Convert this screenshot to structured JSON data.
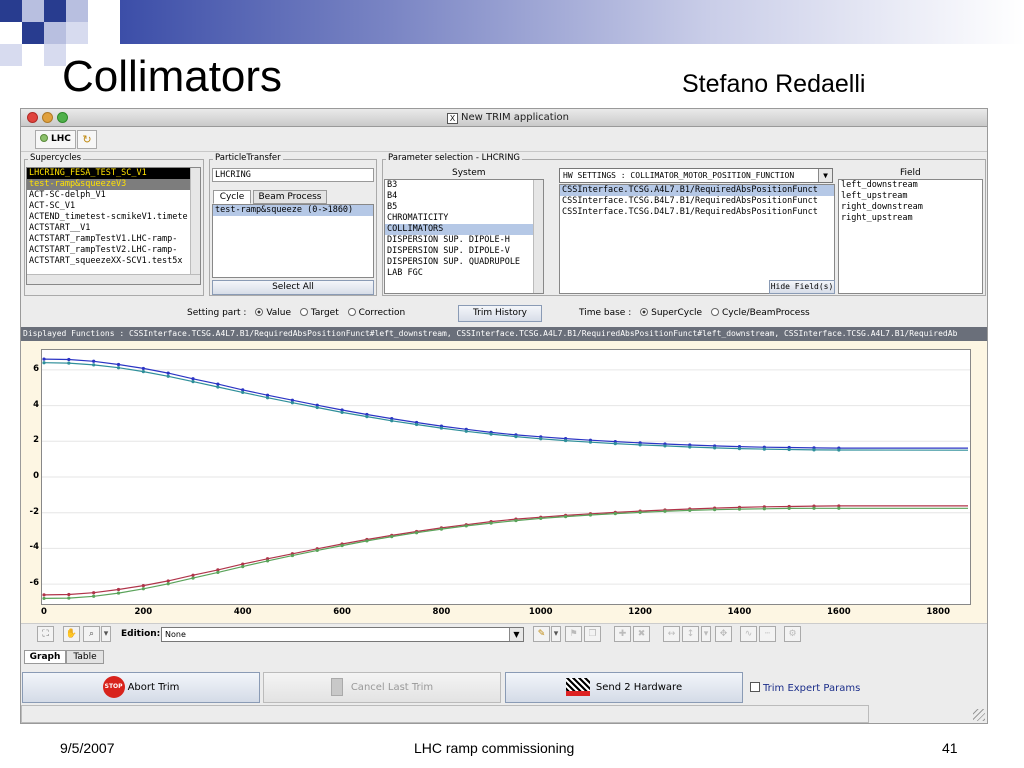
{
  "slide": {
    "title": "Collimators",
    "author": "Stefano Redaelli",
    "date": "9/5/2007",
    "center": "LHC ramp commissioning",
    "page": "41"
  },
  "window": {
    "title": "New TRIM application",
    "x_icon": "X",
    "accelerator_button": "LHC"
  },
  "supercycles": {
    "label": "Supercycles",
    "items": [
      "LHCRING_FESA_TEST_SC_V1",
      "test-ramp&squeezeV3",
      "ACT-SC-delph_V1",
      "ACT-SC_V1",
      "ACTEND_timetest-scmikeV1.timete",
      "ACTSTART__V1",
      "ACTSTART_rampTestV1.LHC-ramp-",
      "ACTSTART_rampTestV2.LHC-ramp-",
      "ACTSTART_squeezeXX-SCV1.test5x"
    ]
  },
  "particle_transfer": {
    "label": "ParticleTransfer",
    "value": "LHCRING",
    "tabs": [
      "Cycle",
      "Beam Process"
    ],
    "items": [
      "test-ramp&squeeze (0->1860)"
    ],
    "select_all": "Select All"
  },
  "parameter_selection": {
    "label": "Parameter selection - LHCRING",
    "system_header": "System",
    "systems": [
      "B3",
      "B4",
      "B5",
      "CHROMATICITY",
      "COLLIMATORS",
      "DISPERSION SUP. DIPOLE-H",
      "DISPERSION SUP. DIPOLE-V",
      "DISPERSION SUP. QUADRUPOLE",
      "LAB FGC"
    ],
    "selected_system": "COLLIMATORS",
    "hw_settings": "HW SETTINGS : COLLIMATOR_MOTOR_POSITION_FUNCTION",
    "parameters": [
      "CSSInterface.TCSG.A4L7.B1/RequiredAbsPositionFunct",
      "CSSInterface.TCSG.B4L7.B1/RequiredAbsPositionFunct",
      "CSSInterface.TCSG.D4L7.B1/RequiredAbsPositionFunct"
    ],
    "field_header": "Field",
    "fields": [
      "left_downstream",
      "left_upstream",
      "right_downstream",
      "right_upstream"
    ],
    "hide_fields": "Hide Field(s)"
  },
  "settings_bar": {
    "setting_part_label": "Setting part :",
    "setting_part_options": [
      "Value",
      "Target",
      "Correction"
    ],
    "setting_part_selected": "Value",
    "trim_history": "Trim History",
    "time_base_label": "Time base :",
    "time_base_options": [
      "SuperCycle",
      "Cycle/BeamProcess"
    ],
    "time_base_selected": "SuperCycle"
  },
  "displayed_functions": "Displayed Functions : CSSInterface.TCSG.A4L7.B1/RequiredAbsPositionFunct#left_downstream, CSSInterface.TCSG.A4L7.B1/RequiredAbsPositionFunct#left_downstream, CSSInterface.TCSG.A4L7.B1/RequiredAb",
  "plot_tools": {
    "edition_label": "Edition:",
    "edition_value": "None"
  },
  "bottom_tabs": [
    "Graph",
    "Table"
  ],
  "actions": {
    "abort": "Abort Trim",
    "cancel": "Cancel Last Trim",
    "send": "Send 2 Hardware",
    "expert": "Trim Expert Params"
  },
  "colors": {
    "series_blue": "#2b34c4",
    "series_teal": "#2f8f9a",
    "series_red": "#b0344a",
    "series_green": "#5aa35a"
  },
  "chart_data": {
    "type": "line",
    "xlim": [
      0,
      1860
    ],
    "ylim": [
      -7,
      7
    ],
    "xticks": [
      "0",
      "200",
      "400",
      "600",
      "800",
      "1000",
      "1200",
      "1400",
      "1600",
      "1800"
    ],
    "yticks": [
      "6",
      "4",
      "2",
      "0",
      "-2",
      "-4",
      "-6"
    ],
    "x": [
      0,
      50,
      100,
      150,
      200,
      250,
      300,
      350,
      400,
      450,
      500,
      550,
      600,
      650,
      700,
      750,
      800,
      850,
      900,
      950,
      1000,
      1050,
      1100,
      1150,
      1200,
      1250,
      1300,
      1350,
      1400,
      1450,
      1500,
      1550,
      1600,
      1860
    ],
    "series": [
      {
        "color": "#2b34c4",
        "values": [
          6.6,
          6.58,
          6.48,
          6.3,
          6.08,
          5.82,
          5.5,
          5.2,
          4.88,
          4.58,
          4.3,
          4.02,
          3.75,
          3.5,
          3.27,
          3.05,
          2.85,
          2.67,
          2.5,
          2.36,
          2.25,
          2.15,
          2.06,
          1.98,
          1.91,
          1.85,
          1.79,
          1.74,
          1.7,
          1.67,
          1.65,
          1.63,
          1.62,
          1.62
        ]
      },
      {
        "color": "#2f8f9a",
        "values": [
          6.4,
          6.38,
          6.28,
          6.12,
          5.9,
          5.64,
          5.34,
          5.04,
          4.74,
          4.44,
          4.16,
          3.89,
          3.62,
          3.38,
          3.15,
          2.94,
          2.74,
          2.56,
          2.4,
          2.26,
          2.14,
          2.04,
          1.95,
          1.87,
          1.8,
          1.74,
          1.68,
          1.63,
          1.59,
          1.56,
          1.54,
          1.52,
          1.51,
          1.5
        ]
      },
      {
        "color": "#b0344a",
        "values": [
          -6.6,
          -6.58,
          -6.48,
          -6.3,
          -6.08,
          -5.82,
          -5.5,
          -5.2,
          -4.88,
          -4.58,
          -4.3,
          -4.02,
          -3.75,
          -3.5,
          -3.27,
          -3.05,
          -2.85,
          -2.67,
          -2.5,
          -2.36,
          -2.25,
          -2.15,
          -2.06,
          -1.98,
          -1.91,
          -1.85,
          -1.79,
          -1.74,
          -1.7,
          -1.67,
          -1.65,
          -1.63,
          -1.62,
          -1.62
        ]
      },
      {
        "color": "#5aa35a",
        "values": [
          -6.8,
          -6.78,
          -6.68,
          -6.5,
          -6.26,
          -5.98,
          -5.66,
          -5.34,
          -5.02,
          -4.7,
          -4.4,
          -4.11,
          -3.84,
          -3.58,
          -3.34,
          -3.12,
          -2.92,
          -2.74,
          -2.58,
          -2.44,
          -2.32,
          -2.22,
          -2.13,
          -2.05,
          -1.98,
          -1.92,
          -1.87,
          -1.83,
          -1.8,
          -1.78,
          -1.76,
          -1.75,
          -1.75,
          -1.75
        ]
      }
    ]
  }
}
